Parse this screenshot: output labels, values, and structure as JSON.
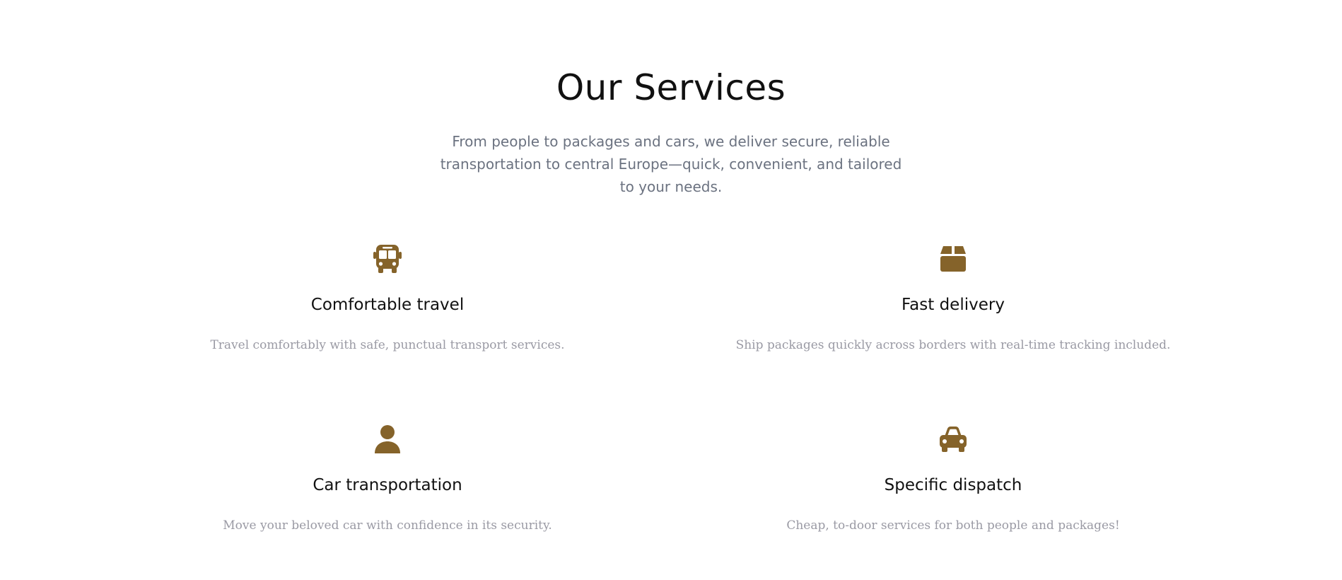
{
  "section": {
    "title": "Our Services",
    "subtitle": "From people to packages and cars, we deliver secure, reliable transportation to central Europe—quick, convenient, and tailored to your needs."
  },
  "accent_color": "#85632a",
  "services": [
    {
      "icon": "bus-icon",
      "title": "Comfortable travel",
      "description": "Travel comfortably with safe, punctual transport services."
    },
    {
      "icon": "box-icon",
      "title": "Fast delivery",
      "description": "Ship packages quickly across borders with real-time tracking included."
    },
    {
      "icon": "user-icon",
      "title": "Car transportation",
      "description": "Move your beloved car with confidence in its security."
    },
    {
      "icon": "car-icon",
      "title": "Specific dispatch",
      "description": "Cheap, to-door services for both people and packages!"
    }
  ]
}
